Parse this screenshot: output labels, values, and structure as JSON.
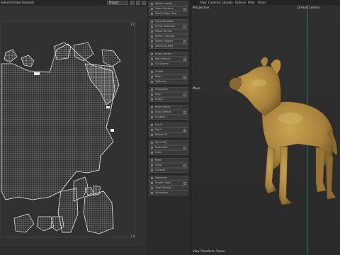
{
  "uv_editor": {
    "menu": [
      "Selection",
      "View",
      "Subtools"
    ],
    "project_dropdown": "Project"
  },
  "tools": {
    "items": [
      "Select Islands",
      "Select Borders",
      "Select Edge Loop",
      "Grow Selection",
      "Shrink Selection",
      "Select Similar",
      "Select Overlaps",
      "Select Flipped",
      "Select by Area",
      "Break Seams",
      "Weld Seams",
      "Cut Seams",
      "Unfold",
      "Relax",
      "Optimize",
      "Straighten",
      "Align",
      "Orient",
      "Pack Islands",
      "Stack Similar",
      "Unstack",
      "Flip U",
      "Flip V",
      "Rotate 90",
      "Fit to Tile",
      "Normalize",
      "Scale",
      "Move",
      "Snap",
      "Checker",
      "Distortion",
      "Stretch View",
      "Texel Density",
      "Symmetry"
    ]
  },
  "viewport": {
    "menu": [
      "View",
      "Cameras",
      "Display",
      "Options",
      "Filter",
      "Panel"
    ],
    "label": "Perspective",
    "camera": "Default Camera",
    "move_label": "Move",
    "status": "View Transform: Scene"
  }
}
